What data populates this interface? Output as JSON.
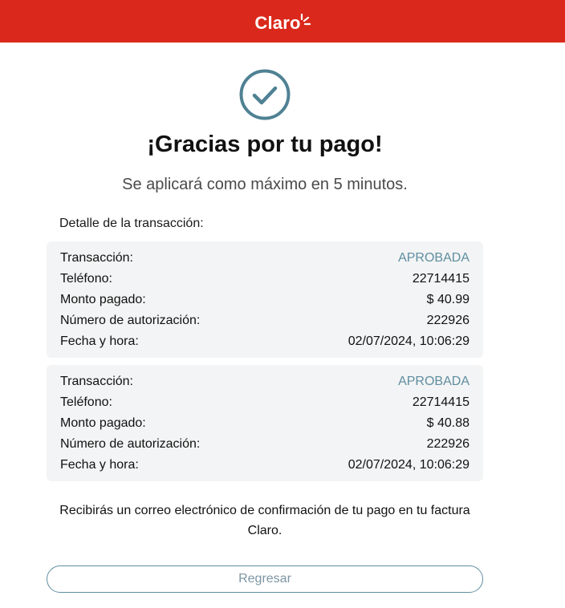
{
  "header": {
    "logo_text": "Claro",
    "brand_color": "#da291c"
  },
  "confirmation": {
    "icon": "check-circle-icon",
    "icon_color": "#4f8193",
    "title": "¡Gracias por tu pago!",
    "subtitle": "Se aplicará como máximo en 5 minutos."
  },
  "details": {
    "heading": "Detalle de la transacción:",
    "transactions": [
      {
        "rows": [
          {
            "label": "Transacción:",
            "value": "APROBADA"
          },
          {
            "label": "Teléfono:",
            "value": "22714415"
          },
          {
            "label": "Monto pagado:",
            "value": "$ 40.99"
          },
          {
            "label": "Número de autorización:",
            "value": "222926"
          },
          {
            "label": "Fecha y hora:",
            "value": "02/07/2024, 10:06:29"
          }
        ]
      },
      {
        "rows": [
          {
            "label": "Transacción:",
            "value": "APROBADA"
          },
          {
            "label": "Teléfono:",
            "value": "22714415"
          },
          {
            "label": "Monto pagado:",
            "value": "$ 40.88"
          },
          {
            "label": "Número de autorización:",
            "value": "222926"
          },
          {
            "label": "Fecha y hora:",
            "value": "02/07/2024, 10:06:29"
          }
        ]
      }
    ],
    "status_color": "#5f8ea0"
  },
  "note": {
    "text": "Recibirás un correo electrónico de confirmación de tu pago en tu factura Claro."
  },
  "actions": {
    "back_label": "Regresar"
  }
}
